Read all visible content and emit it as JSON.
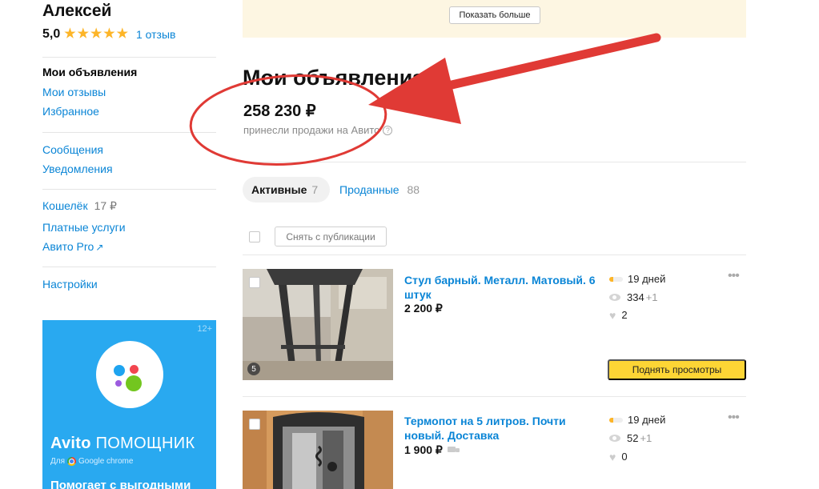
{
  "profile": {
    "name": "Алексей",
    "rating": "5,0",
    "stars": 5,
    "reviews": "1 отзыв"
  },
  "sidebar": {
    "items": [
      {
        "label": "Мои объявления"
      },
      {
        "label": "Мои отзывы"
      },
      {
        "label": "Избранное"
      },
      {
        "label": "Сообщения"
      },
      {
        "label": "Уведомления"
      },
      {
        "label": "Кошелёк"
      },
      {
        "label": "Платные услуги"
      },
      {
        "label": "Авито Pro"
      },
      {
        "label": "Настройки"
      }
    ],
    "wallet_value": "17 ₽",
    "external_icon": "external-link-icon"
  },
  "banner": {
    "age": "12+",
    "brand": "Avito",
    "product": "ПОМОЩНИК",
    "for": "Для",
    "browser": "Google chrome",
    "tagline": "Помогает с выгодными"
  },
  "top": {
    "show_more": "Показать больше"
  },
  "main": {
    "heading": "Мои объявления",
    "amount": "258 230 ₽",
    "amount_caption": "принесли продажи на Авито",
    "help_icon": "?",
    "tabs": [
      {
        "label": "Активные",
        "count": "7"
      },
      {
        "label": "Проданные",
        "count": "88"
      }
    ],
    "unpublish": "Снять с публикации"
  },
  "listings": [
    {
      "title": "Стул барный. Металл. Матовый. 6 штук",
      "price": "2 200 ₽",
      "photos": "5",
      "days": "19 дней",
      "views": "334",
      "views_new": "+1",
      "favs": "2",
      "delivery": false,
      "action": "Поднять просмотры"
    },
    {
      "title": "Термопот на 5 литров. Почти новый. Доставка",
      "price": "1 900 ₽",
      "days": "19 дней",
      "views": "52",
      "views_new": "+1",
      "favs": "0",
      "delivery": true
    }
  ],
  "colors": {
    "link": "#0a85d6",
    "star": "#fdb528",
    "accent_button": "#fdd535",
    "banner": "#29a9f0",
    "annotation": "#e03a35"
  }
}
